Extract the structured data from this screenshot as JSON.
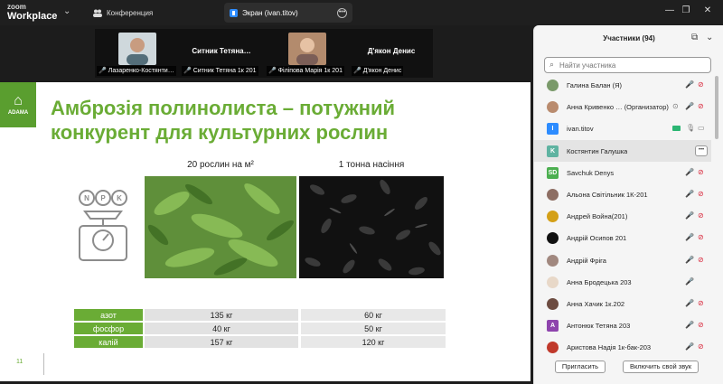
{
  "app": {
    "logo_top": "zoom",
    "logo_bottom": "Workplace"
  },
  "tabs": [
    {
      "label": "Конференция",
      "icon": "people-icon"
    },
    {
      "label": "Экран (ivan.titov)",
      "icon": "screen-icon"
    }
  ],
  "video_strip": [
    {
      "top_name": "",
      "caption": "Лазаренко-Костянти…",
      "has_photo": true
    },
    {
      "top_name": "Ситник  Тетяна…",
      "caption": "Ситник Тетяна 1к 201",
      "has_photo": false
    },
    {
      "top_name": "",
      "caption": "Філіпова Марія 1к 201",
      "has_photo": true
    },
    {
      "top_name": "Д'якон Денис",
      "caption": "Д'якон Денис",
      "has_photo": false
    }
  ],
  "slide": {
    "brand": "ADAMA",
    "title_line1": "Амброзія полинолиста – потужний",
    "title_line2": "конкурент для культурних рослин",
    "col1_header": "20 рослин на м²",
    "col2_header": "1 тонна насіння",
    "scale_letters": [
      "N",
      "P",
      "K"
    ],
    "rows": [
      {
        "label": "азот",
        "v1": "135 кг",
        "v2": "60 кг"
      },
      {
        "label": "фосфор",
        "v1": "40 кг",
        "v2": "50 кг"
      },
      {
        "label": "калій",
        "v1": "157 кг",
        "v2": "120 кг"
      }
    ],
    "page_number": "11",
    "accent_color": "#6aac35"
  },
  "panel": {
    "title": "Участники (94)",
    "search_placeholder": "Найти участника",
    "participants": [
      {
        "name": "Галина Балан (Я)",
        "avatar": "photo",
        "avatar_color": "#7a9a6a",
        "initials": ""
      },
      {
        "name": "Анна Кривенко … (Организатор)",
        "avatar": "photo",
        "avatar_color": "#b98b6e",
        "initials": ""
      },
      {
        "name": "ivan.titov",
        "avatar": "initials",
        "avatar_color": "#2d8cff",
        "initials": "I"
      },
      {
        "name": "Костянтин Галушка",
        "avatar": "initials",
        "avatar_color": "#5fb3a1",
        "initials": "K"
      },
      {
        "name": "Savchuk Denys",
        "avatar": "initials",
        "avatar_color": "#4caf50",
        "initials": "SD"
      },
      {
        "name": "Альона Світільник 1К-201",
        "avatar": "photo",
        "avatar_color": "#8d6e63",
        "initials": ""
      },
      {
        "name": "Андрей Война(201)",
        "avatar": "photo",
        "avatar_color": "#d4a017",
        "initials": ""
      },
      {
        "name": "Андрій Осипов 201",
        "avatar": "photo",
        "avatar_color": "#111111",
        "initials": ""
      },
      {
        "name": "Андрій Фріга",
        "avatar": "photo",
        "avatar_color": "#a1887f",
        "initials": ""
      },
      {
        "name": "Анна Бродецька 203",
        "avatar": "photo",
        "avatar_color": "#e8d8c8",
        "initials": ""
      },
      {
        "name": "Анна Хачик 1к.202",
        "avatar": "photo",
        "avatar_color": "#6d4c41",
        "initials": ""
      },
      {
        "name": "Антонюк Тетяна 203",
        "avatar": "initials",
        "avatar_color": "#8e44ad",
        "initials": "A"
      },
      {
        "name": "Аристова Надія 1к-бак-203",
        "avatar": "photo",
        "avatar_color": "#c0392b",
        "initials": ""
      }
    ],
    "invite_label": "Пригласить",
    "unmute_label": "Включить свой звук"
  }
}
